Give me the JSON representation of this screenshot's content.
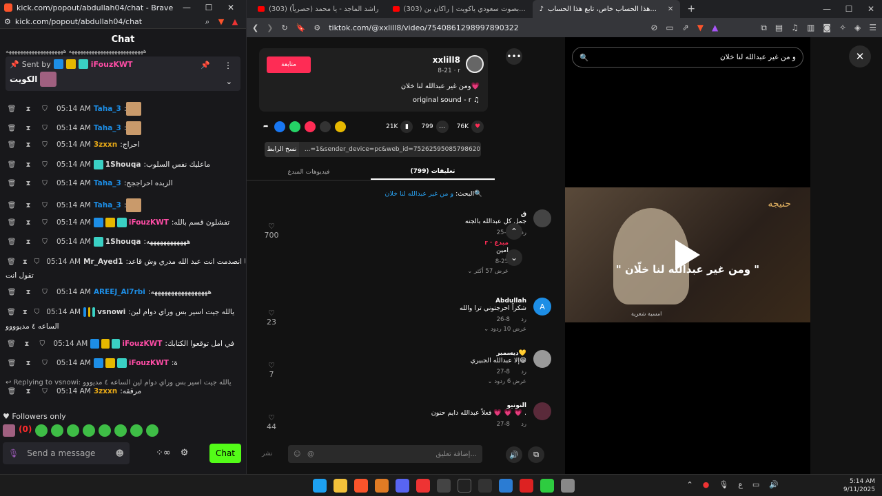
{
  "left": {
    "title": "kick.com/popout/abdullah04/chat - Brave",
    "url": "kick.com/popout/abdullah04/chat",
    "chat_header": "Chat",
    "cut_line": "ههههههههههههههههههههههههههه ههههههههههههههههههههه",
    "pinned": {
      "sent_by_label": "Sent by",
      "sender": "iFouzKWT",
      "text": "الكويت"
    },
    "messages": [
      {
        "time": "05:14 AM",
        "user": "Taha_3",
        "color": "#1d8ee6",
        "text": "",
        "emote": true
      },
      {
        "time": "05:14 AM",
        "user": "Taha_3",
        "color": "#1d8ee6",
        "text": "",
        "emote": true
      },
      {
        "time": "05:14 AM",
        "user": "3zxxn",
        "color": "#e6a817",
        "text": "احراج"
      },
      {
        "time": "05:14 AM",
        "user": "1Shouqa",
        "color": "#dddddd",
        "text": "ماعليك نفس السلوب",
        "badge": true
      },
      {
        "time": "05:14 AM",
        "user": "Taha_3",
        "color": "#1d8ee6",
        "text": "الزبده احراججج"
      },
      {
        "time": "05:14 AM",
        "user": "Taha_3",
        "color": "#1d8ee6",
        "text": "",
        "emote": true
      },
      {
        "time": "05:14 AM",
        "user": "iFouzKWT",
        "color": "#ff4da6",
        "text": "تفشلون قسم بالله",
        "badges3": true
      },
      {
        "time": "05:14 AM",
        "user": "1Shouqa",
        "color": "#dddddd",
        "text": "ههههههههههههه",
        "badge": true
      },
      {
        "time": "05:14 AM",
        "user": "Mr_Ayed1",
        "color": "#dddddd",
        "text": "حدا انا انصدمت انت عبد الله مدري وش قاعد"
      },
      {
        "time": "05:14 AM",
        "user": "AREEJ_Al7rbi",
        "color": "#1d8ee6",
        "text": "هههههههههههههههههه"
      },
      {
        "time": "05:14 AM",
        "user": "vsnowi",
        "color": "#dddddd",
        "text": "يالله جيت اسير بس وراي دوام لين",
        "badges3": true
      },
      {
        "time": "05:14 AM",
        "user": "iFouzKWT",
        "color": "#ff4da6",
        "text": "في امل توقعوا الكتابك",
        "badges3": true
      },
      {
        "time": "05:14 AM",
        "user": "iFouzKWT",
        "color": "#ff4da6",
        "text": "ة",
        "badges3": true
      },
      {
        "time": "05:14 AM",
        "user": "3zxxn",
        "color": "#e6a817",
        "text": "مرققه"
      }
    ],
    "continuations": {
      "m9": "تقول انت",
      "m11": "الساعه ٤ مديوووو"
    },
    "reply_text": "Replying to vsnowi: يالله جيت اسير بس وراي دوام لين الساعه ٤ مديووو",
    "followers_only": "Followers only",
    "emote_red": "(0)",
    "input_placeholder": "Send a message",
    "chat_button": "Chat"
  },
  "right": {
    "tabs": [
      {
        "label": "(303) راشد الماجد - يا محمد (حصرياً)",
        "active": false
      },
      {
        "label": "(303) بصوت سعودي ياكويت | راكان بن...",
        "active": false
      },
      {
        "label": "هذا الحساب خاص، تابع هذا الحساب...",
        "active": true
      }
    ],
    "url": "tiktok.com/@xxlill8/video/7540861298997890322",
    "follow_label": "متابعة",
    "username": "xxlill8",
    "date": "8-21 · r",
    "caption": "ومن غير عبدالله لنا خلان💗",
    "sound": "original sound - r ♫",
    "stats": {
      "likes": "76K",
      "comments": "799",
      "saves": "21K"
    },
    "copy_link": "نسخ الرابط",
    "link_text": "...=1&sender_device=pc&web_id=7526259508579862072",
    "tab_comments": "تعليقات (799)",
    "tab_creator": "فيديوهات المبدع",
    "search_label": "البحث:",
    "search_query": "و من غير عبدالله لنا خلان",
    "comments": [
      {
        "name": "ق",
        "text": "جمل كل عبدالله بالجنه",
        "date": "8-25",
        "reply": "رد",
        "likes": "700",
        "sub": {
          "name": "r · مبدع",
          "text": "امين",
          "date": "8-25"
        },
        "more": "عرض 57 أكثر"
      },
      {
        "name": "Abdullah",
        "text": "شكراً احرجتوني ترا والله",
        "date": "8-26",
        "reply": "رد",
        "likes": "23",
        "more": "عرض 10 ردود"
      },
      {
        "name": "ديسمبر💛",
        "text": "إلا عبدالله الجبيري😁",
        "date": "8-27",
        "reply": "رد",
        "likes": "7",
        "more": "عرض 6 ردود"
      },
      {
        "name": "النونيو",
        "text": "فعلاً عبدالله دايم حنون 💗 💗 💗 .",
        "date": "8-27",
        "reply": "رد",
        "likes": "44"
      }
    ],
    "add_comment": "إضافة تعليق...",
    "post_label": "نشر",
    "video_search": "و من غير عبدالله لنا خلان",
    "video_caption": "\" ومن غير عبدالله لنا خلّان \"",
    "video_logo": "حنيجه",
    "video_watermark": "امسية شعرية"
  },
  "taskbar": {
    "lang": "ع",
    "time": "5:14 AM",
    "date": "9/11/2025"
  }
}
